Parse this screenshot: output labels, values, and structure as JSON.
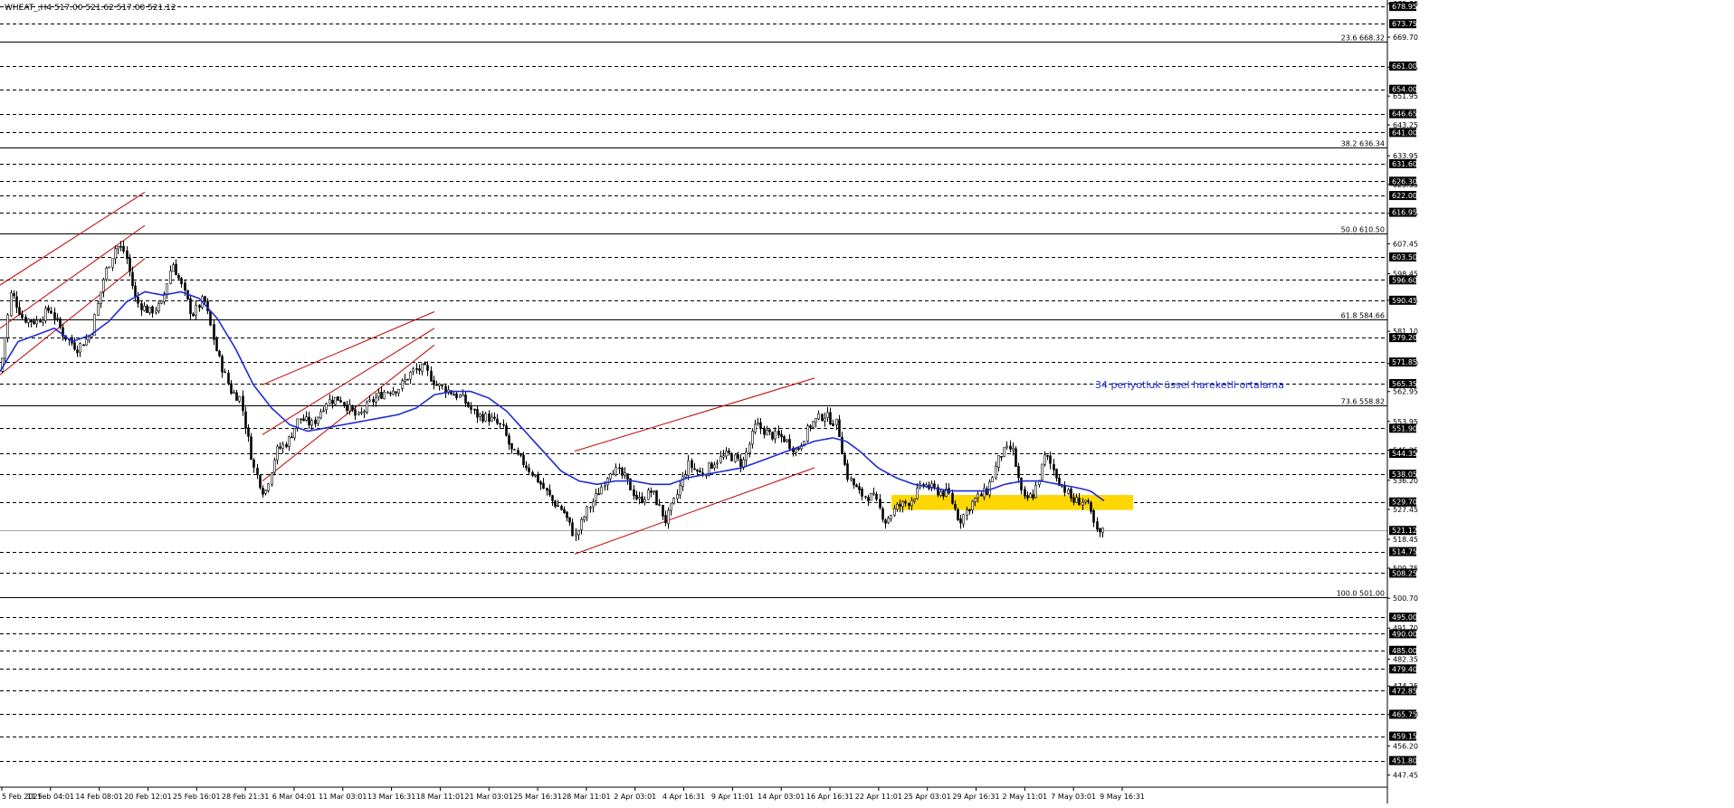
{
  "header": {
    "symbol_line": "WHEAT_,H4  517.00 521.62 517.00 521.12"
  },
  "annotation": {
    "ema_label": "34 periyotluk üssel hareketli ortalama"
  },
  "colors": {
    "background": "#ffffff",
    "candle": "#000000",
    "ema": "#1f2bd6",
    "channel": "#c00000",
    "zone": "#ffd700",
    "label_box": "#000000",
    "label_text": "#ffffff"
  },
  "chart_data": {
    "type": "candlestick",
    "title": "",
    "symbol": "WHEAT_",
    "timeframe": "H4",
    "ohlc_header": {
      "open": 517.0,
      "high": 521.62,
      "low": 517.0,
      "close": 521.12
    },
    "current_price": 521.12,
    "ylim": [
      444.6,
      679.8
    ],
    "x_tick_labels": [
      "5 Feb 2025",
      "11 Feb 04:01",
      "14 Feb 08:01",
      "20 Feb 12:01",
      "25 Feb 16:01",
      "28 Feb 21:31",
      "6 Mar 04:01",
      "11 Mar 03:01",
      "13 Mar 16:31",
      "18 Mar 11:01",
      "21 Mar 03:01",
      "25 Mar 16:31",
      "28 Mar 11:01",
      "2 Apr 03:01",
      "4 Apr 16:31",
      "9 Apr 11:01",
      "14 Apr 03:01",
      "16 Apr 16:31",
      "22 Apr 11:01",
      "25 Apr 03:01",
      "29 Apr 16:31",
      "2 May 11:01",
      "7 May 03:01",
      "9 May 16:31"
    ],
    "y_tick_labels": [
      "679.80",
      "669.70",
      "660.65",
      "651.95",
      "643.25",
      "633.95",
      "625.35",
      "616.65",
      "607.45",
      "598.45",
      "590.45",
      "581.10",
      "571.40",
      "562.95",
      "553.95",
      "545.25",
      "536.20",
      "527.45",
      "518.45",
      "509.75",
      "500.70",
      "491.70",
      "482.35",
      "474.25",
      "465.70",
      "456.20",
      "447.45"
    ],
    "horizontal_levels": [
      678.95,
      673.75,
      661.0,
      654.0,
      646.65,
      641.0,
      631.6,
      626.3,
      622.0,
      616.95,
      603.5,
      596.6,
      590.45,
      579.2,
      571.85,
      565.35,
      551.9,
      544.35,
      538.05,
      529.7,
      521.12,
      514.75,
      508.25,
      495.0,
      490.0,
      485.0,
      479.4,
      472.85,
      465.75,
      459.15,
      451.8
    ],
    "fibonacci_levels": [
      {
        "ratio": "23.6",
        "price": 668.32
      },
      {
        "ratio": "38.2",
        "price": 636.34
      },
      {
        "ratio": "50.0",
        "price": 610.5
      },
      {
        "ratio": "61.8",
        "price": 584.66
      },
      {
        "ratio": "73.6",
        "price": 558.82
      },
      {
        "ratio": "100.0",
        "price": 501.0
      }
    ],
    "price_anchors": [
      [
        0,
        569
      ],
      [
        12,
        593
      ],
      [
        25,
        585
      ],
      [
        40,
        584
      ],
      [
        55,
        588
      ],
      [
        70,
        580
      ],
      [
        85,
        576
      ],
      [
        100,
        580
      ],
      [
        115,
        598
      ],
      [
        128,
        607
      ],
      [
        138,
        605
      ],
      [
        150,
        590
      ],
      [
        165,
        587
      ],
      [
        178,
        589
      ],
      [
        190,
        602
      ],
      [
        200,
        595
      ],
      [
        212,
        586
      ],
      [
        225,
        591
      ],
      [
        240,
        574
      ],
      [
        255,
        563
      ],
      [
        265,
        561
      ],
      [
        280,
        540
      ],
      [
        292,
        532
      ],
      [
        305,
        545
      ],
      [
        318,
        548
      ],
      [
        330,
        555
      ],
      [
        345,
        553
      ],
      [
        360,
        560
      ],
      [
        375,
        561
      ],
      [
        395,
        555
      ],
      [
        410,
        560
      ],
      [
        425,
        563
      ],
      [
        440,
        564
      ],
      [
        455,
        569
      ],
      [
        468,
        570
      ],
      [
        482,
        565
      ],
      [
        497,
        563
      ],
      [
        510,
        561
      ],
      [
        525,
        556
      ],
      [
        540,
        555
      ],
      [
        555,
        552
      ],
      [
        565,
        545
      ],
      [
        580,
        541
      ],
      [
        595,
        536
      ],
      [
        610,
        530
      ],
      [
        622,
        527
      ],
      [
        635,
        519
      ],
      [
        648,
        527
      ],
      [
        660,
        532
      ],
      [
        675,
        540
      ],
      [
        690,
        537
      ],
      [
        705,
        530
      ],
      [
        720,
        533
      ],
      [
        735,
        524
      ],
      [
        745,
        530
      ],
      [
        760,
        541
      ],
      [
        775,
        538
      ],
      [
        790,
        542
      ],
      [
        805,
        544
      ],
      [
        820,
        541
      ],
      [
        835,
        553
      ],
      [
        850,
        550
      ],
      [
        865,
        549
      ],
      [
        880,
        545
      ],
      [
        895,
        553
      ],
      [
        910,
        556
      ],
      [
        925,
        553
      ],
      [
        935,
        538
      ],
      [
        950,
        532
      ],
      [
        965,
        531
      ],
      [
        978,
        524
      ],
      [
        990,
        528
      ],
      [
        1005,
        530
      ],
      [
        1020,
        535
      ],
      [
        1035,
        533
      ],
      [
        1048,
        532
      ],
      [
        1060,
        524
      ],
      [
        1075,
        530
      ],
      [
        1090,
        533
      ],
      [
        1105,
        544
      ],
      [
        1118,
        546
      ],
      [
        1130,
        530
      ],
      [
        1142,
        532
      ],
      [
        1155,
        544
      ],
      [
        1170,
        536
      ],
      [
        1185,
        530
      ],
      [
        1200,
        530
      ],
      [
        1212,
        520
      ],
      [
        1220,
        521
      ]
    ],
    "ema_anchors": [
      [
        0,
        569
      ],
      [
        20,
        578
      ],
      [
        40,
        580
      ],
      [
        60,
        582
      ],
      [
        80,
        578
      ],
      [
        100,
        580
      ],
      [
        120,
        584
      ],
      [
        140,
        590
      ],
      [
        160,
        593
      ],
      [
        180,
        592
      ],
      [
        200,
        593
      ],
      [
        220,
        591
      ],
      [
        240,
        585
      ],
      [
        260,
        576
      ],
      [
        280,
        565
      ],
      [
        300,
        558
      ],
      [
        320,
        553
      ],
      [
        340,
        551
      ],
      [
        360,
        552
      ],
      [
        380,
        553
      ],
      [
        400,
        554
      ],
      [
        420,
        555
      ],
      [
        440,
        556
      ],
      [
        460,
        558
      ],
      [
        480,
        562
      ],
      [
        500,
        563
      ],
      [
        520,
        563
      ],
      [
        540,
        561
      ],
      [
        560,
        557
      ],
      [
        580,
        551
      ],
      [
        600,
        545
      ],
      [
        620,
        539
      ],
      [
        640,
        536
      ],
      [
        660,
        535
      ],
      [
        680,
        536
      ],
      [
        700,
        536
      ],
      [
        720,
        535
      ],
      [
        740,
        535
      ],
      [
        760,
        537
      ],
      [
        780,
        538
      ],
      [
        800,
        539
      ],
      [
        820,
        540
      ],
      [
        840,
        542
      ],
      [
        860,
        544
      ],
      [
        880,
        546
      ],
      [
        900,
        548
      ],
      [
        920,
        549
      ],
      [
        935,
        548
      ],
      [
        950,
        545
      ],
      [
        970,
        540
      ],
      [
        990,
        537
      ],
      [
        1010,
        535
      ],
      [
        1030,
        534
      ],
      [
        1050,
        533
      ],
      [
        1070,
        533
      ],
      [
        1090,
        533
      ],
      [
        1110,
        535
      ],
      [
        1130,
        536
      ],
      [
        1150,
        536
      ],
      [
        1170,
        535
      ],
      [
        1190,
        534
      ],
      [
        1205,
        533
      ],
      [
        1220,
        530
      ]
    ],
    "rising_channels": [
      {
        "lower": [
          [
            0,
            568
          ],
          [
            160,
            603
          ]
        ],
        "upper": [
          [
            0,
            595
          ],
          [
            160,
            623
          ]
        ],
        "middle": [
          [
            0,
            582
          ],
          [
            160,
            613
          ]
        ]
      },
      {
        "lower": [
          [
            290,
            536
          ],
          [
            480,
            577
          ]
        ],
        "upper": [
          [
            290,
            565
          ],
          [
            480,
            587
          ]
        ],
        "middle": [
          [
            290,
            550
          ],
          [
            480,
            582
          ]
        ]
      },
      {
        "lower": [
          [
            635,
            514
          ],
          [
            900,
            540
          ]
        ],
        "upper": [
          [
            635,
            545
          ],
          [
            900,
            567
          ]
        ]
      }
    ],
    "support_zone": {
      "x_range": [
        985,
        1252
      ],
      "price_range": [
        527.3,
        531.8
      ]
    }
  }
}
